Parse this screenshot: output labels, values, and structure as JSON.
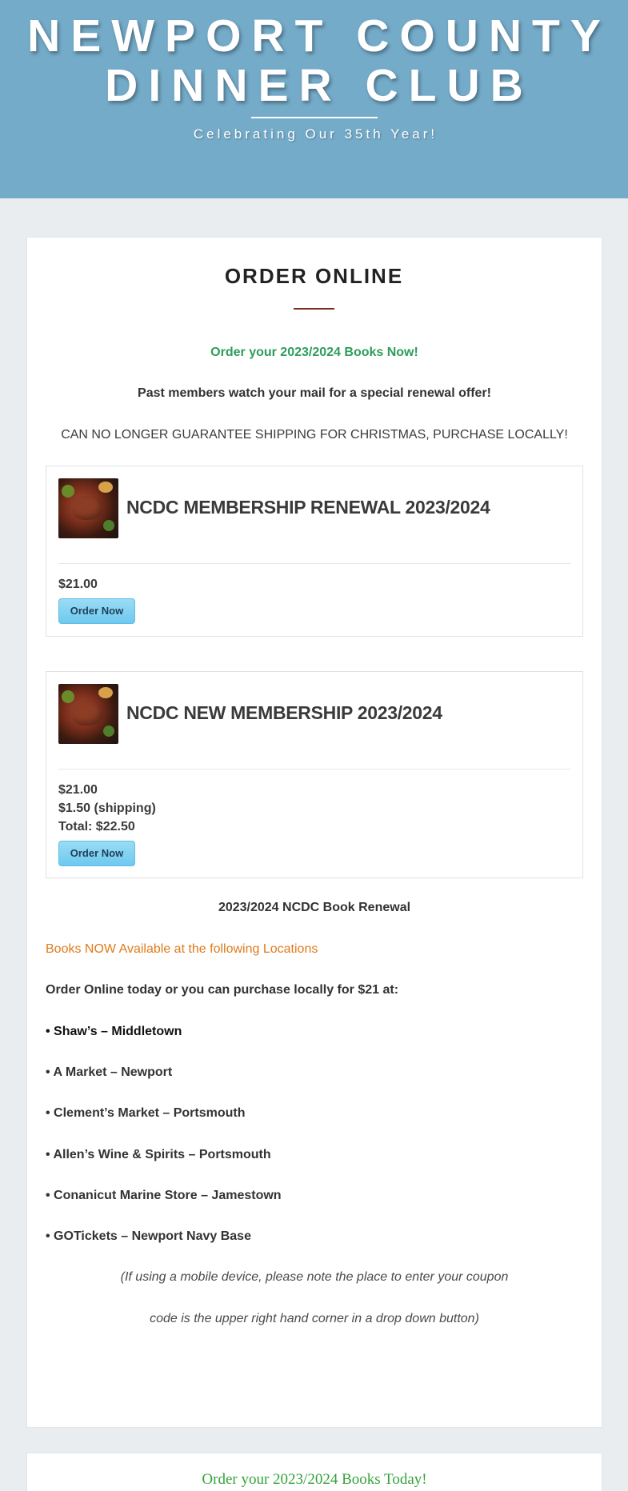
{
  "header": {
    "title_line1": "NEWPORT COUNTY",
    "title_line2": "DINNER CLUB",
    "tagline": "Celebrating Our 35th Year!"
  },
  "main": {
    "heading": "ORDER ONLINE",
    "intro": {
      "order_books": "Order your 2023/2024 Books Now!",
      "renewal_offer": "Past members watch your mail for a special renewal offer!",
      "shipping_notice": "CAN NO LONGER GUARANTEE SHIPPING FOR CHRISTMAS, PURCHASE LOCALLY!"
    },
    "products": [
      {
        "title": "NCDC MEMBERSHIP RENEWAL 2023/2024",
        "price": "$21.00",
        "button": "Order Now"
      },
      {
        "title": "NCDC NEW MEMBERSHIP 2023/2024",
        "price": "$21.00",
        "shipping": "$1.50 (shipping)",
        "total": "Total: $22.50",
        "button": "Order Now"
      }
    ],
    "renewal_heading": "2023/2024 NCDC Book Renewal",
    "locations_heading": "Books NOW Available at the following Locations",
    "order_text": "Order Online today or you can purchase locally for $21 at:",
    "locations": [
      "• Shaw’s – Middletown",
      "• A Market – Newport",
      "• Clement’s Market – Portsmouth",
      "• Allen’s Wine & Spirits – Portsmouth",
      "• Conanicut Marine Store – Jamestown",
      "• GOTickets – Newport Navy Base"
    ],
    "mobile_note_line1": "(If using a mobile device, please note the place to enter your coupon",
    "mobile_note_line2": "code is the upper right hand corner in a drop down button)"
  },
  "footer_card": {
    "text": "Order your 2023/2024 Books Today!"
  },
  "colors": {
    "header_bg": "#74abc9",
    "accent_green": "#2e9c5a",
    "accent_orange": "#e07b1a",
    "button_blue": "#6ec9ef",
    "heading_rule": "#7a2c1e"
  }
}
